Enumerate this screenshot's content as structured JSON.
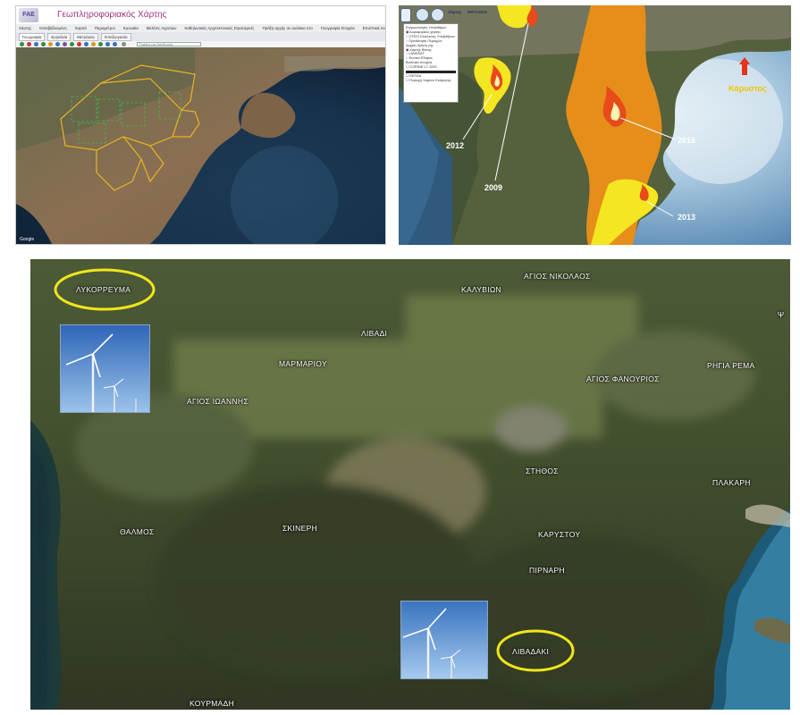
{
  "gis_app": {
    "app_title": "Γεωπληροφοριακός Χάρτης",
    "logo_text": "FAE",
    "menu_items": [
      "Χάρτης",
      "Καταβιβλιομένη",
      "Χαρτιά",
      "Παραμέτροι",
      "Χρονιαία",
      "Μελέτες Αγροτών",
      "Καθηλωτικές Αρχιτεκτονικές Στρατηγικές",
      "Πράξη αρχής σε αυλάκια στο",
      "Γεωγραφία Στοιχεία",
      "Εποπτικά Αναπαραστάσεις"
    ],
    "tabs": [
      "Γεωγραφία",
      "Εργαλεία",
      "Μετρήσεις",
      "Επεξεργασία"
    ],
    "search_placeholder": "Γράψτε μια διεύθυνση",
    "attribution": "Google"
  },
  "fire_map": {
    "toolbar_labels": [
      "Χάρτης",
      "ΕΡΓΑΛΕΙΑ"
    ],
    "layer_panel": [
      "Ενεργοποίηση Υποβάθρου",
      "Δορυφορικός χάρτης",
      "ΟΤΕ/Ο Εκτέλεσης Υποβάθρου",
      "Οριοθέτηση Περιοχών",
      "Αρχική Χρήση γης",
      "Χάρτης Βάσης",
      "LANDSAT",
      "Φυσικό Εδάφος",
      "Βασιλικά στοιχεία",
      "CORINE LC 2000",
      "ΚΕΠΑΔ",
      "Περιοχή Χαρτών Εκτίμησης"
    ],
    "fire_years": [
      "2012",
      "2009",
      "2016",
      "2013"
    ],
    "town_label": "Κάρυστος",
    "colors": {
      "burn_2016": "#e58e1a",
      "burn_other": "#f4e620",
      "flame": "#e84a1a",
      "arrow": "#e8331a",
      "town": "#f2c400"
    }
  },
  "satellite_map": {
    "highlighted_sites": [
      "ΛΥΚΟΡΡΕΥΜΑ",
      "ΛΙΒΑΔΑΚΙ"
    ],
    "places": [
      "ΚΑΛΥΒΙΩΝ",
      "ΑΓΙΟΣ ΝΙΚΟΛΑΟΣ",
      "ΛΙΒΑΔΙ",
      "ΜΑΡΜΑΡΙΟΥ",
      "ΑΓΙΟΣ ΙΩΑΝΝΗΣ",
      "ΑΓΙΟΣ ΦΑΝΟΥΡΙΟΣ",
      "ΡΗΓΙΑ ΡΕΜΑ",
      "ΣΤΗΘΟΣ",
      "ΠΛΑΚΑΡΗ",
      "ΘΑΛΜΟΣ",
      "ΣΚΙΝΕΡΗ",
      "ΚΑΡΥΣΤΟΥ",
      "ΠΙΡΝΑΡΗ",
      "ΚΟΥΡΜΑΔΗ",
      "Ψ"
    ],
    "highlight_color": "#f0e51a"
  }
}
